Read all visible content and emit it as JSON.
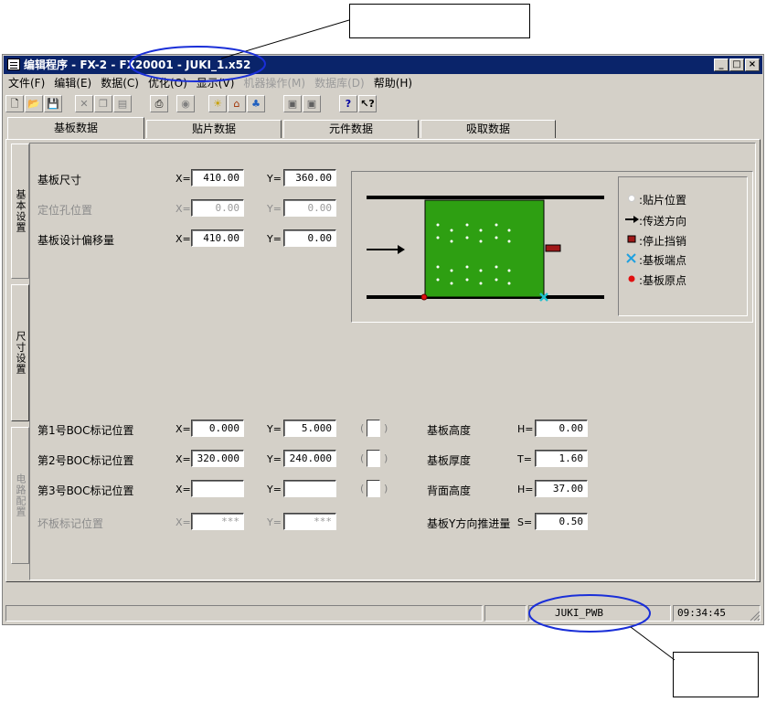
{
  "window": {
    "title": "编辑程序 - FX-2 - FX20001 - JUKI_1.x52",
    "min_icon": "minimize-icon",
    "max_icon": "maximize-icon",
    "close_icon": "close-icon"
  },
  "menu": [
    {
      "label": "文件(F)",
      "enabled": true
    },
    {
      "label": "编辑(E)",
      "enabled": true
    },
    {
      "label": "数据(C)",
      "enabled": true
    },
    {
      "label": "优化(O)",
      "enabled": true
    },
    {
      "label": "显示(V)",
      "enabled": true
    },
    {
      "label": "机器操作(M)",
      "enabled": false
    },
    {
      "label": "数据库(D)",
      "enabled": false
    },
    {
      "label": "帮助(H)",
      "enabled": true
    }
  ],
  "toolbar": [
    "new-icon",
    "open-icon",
    "save-icon",
    "cut-icon",
    "copy-icon",
    "paste-icon",
    "print-icon",
    "find-icon",
    "bulb-icon",
    "optimize-icon",
    "components-icon",
    "import-icon",
    "export-icon",
    "help-icon",
    "context-help-icon"
  ],
  "tabs": [
    "基板数据",
    "贴片数据",
    "元件数据",
    "吸取数据"
  ],
  "side_tabs": [
    "基本设置",
    "尺寸设置",
    "电路配置"
  ],
  "board": {
    "size_label": "基板尺寸",
    "size_x": "410.00",
    "size_y": "360.00",
    "hole_label": "定位孔位置",
    "hole_x": "0.00",
    "hole_y": "0.00",
    "offset_label": "基板设计偏移量",
    "offset_x": "410.00",
    "offset_y": "0.00",
    "x_prefix": "X=",
    "y_prefix": "Y="
  },
  "legend": [
    {
      "icon": "white-dot-icon",
      "label": ":贴片位置"
    },
    {
      "icon": "arrow-right-icon",
      "label": ":传送方向"
    },
    {
      "icon": "stopper-icon",
      "label": ":停止挡销"
    },
    {
      "icon": "board-end-icon",
      "label": ":基板端点"
    },
    {
      "icon": "origin-dot-icon",
      "label": ":基板原点"
    }
  ],
  "marks": [
    {
      "label": "第1号BOC标记位置",
      "x": "0.000",
      "y": "5.000",
      "paren_l": "(",
      "paren_r": ")"
    },
    {
      "label": "第2号BOC标记位置",
      "x": "320.000",
      "y": "240.000",
      "paren_l": "(",
      "paren_r": ")"
    },
    {
      "label": "第3号BOC标记位置",
      "x": "",
      "y": "",
      "paren_l": "(",
      "paren_r": ")"
    },
    {
      "label": "坏板标记位置",
      "x": "***",
      "y": "***"
    }
  ],
  "heights": [
    {
      "label": "基板高度",
      "prefix": "H=",
      "value": "0.00"
    },
    {
      "label": "基板厚度",
      "prefix": "T=",
      "value": "1.60"
    },
    {
      "label": "背面高度",
      "prefix": "H=",
      "value": "37.00"
    },
    {
      "label": "基板Y方向推进量",
      "prefix": "S=",
      "value": "0.50"
    }
  ],
  "status": {
    "pwb": "JUKI_PWB",
    "time": "09:34:45"
  },
  "colors": {
    "board_green": "#2e9f12",
    "title_blue": "#0a246a",
    "callout_blue": "#1a2fd8"
  }
}
